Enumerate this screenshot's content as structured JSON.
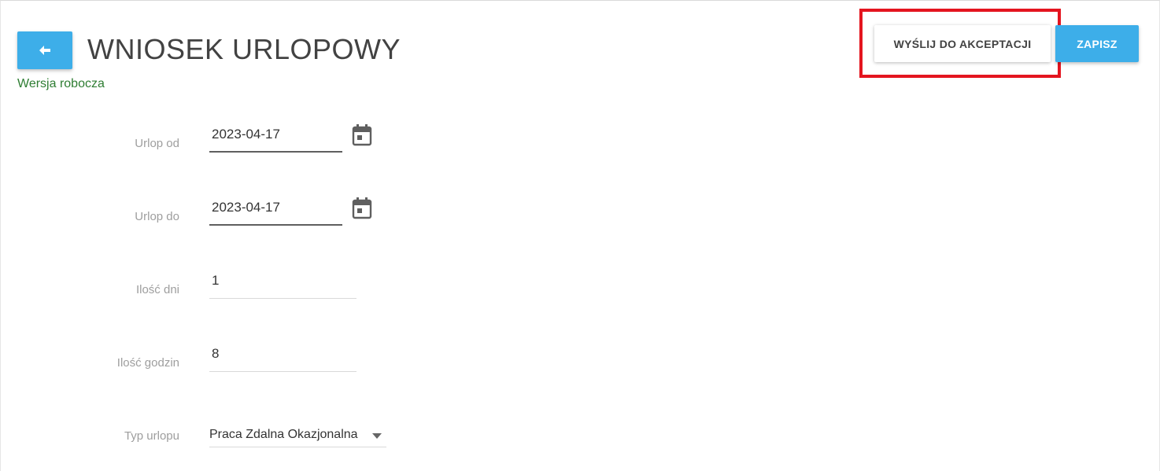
{
  "header": {
    "back_icon": "arrow-left-icon",
    "title": "WNIOSEK URLOPOWY",
    "status": "Wersja robocza",
    "status_color": "#2e7d32"
  },
  "actions": {
    "send_for_approval": "WYŚLIJ DO AKCEPTACJI",
    "save": "ZAPISZ",
    "accent_color": "#3daee9",
    "highlight_color": "#e4151f"
  },
  "form": {
    "leave_from": {
      "label": "Urlop od",
      "value": "2023-04-17",
      "icon": "calendar-icon"
    },
    "leave_to": {
      "label": "Urlop do",
      "value": "2023-04-17",
      "icon": "calendar-icon"
    },
    "days": {
      "label": "Ilość dni",
      "value": "1"
    },
    "hours": {
      "label": "Ilość godzin",
      "value": "8"
    },
    "leave_type": {
      "label": "Typ urlopu",
      "value": "Praca Zdalna Okazjonalna",
      "icon": "dropdown-arrow-icon"
    }
  }
}
